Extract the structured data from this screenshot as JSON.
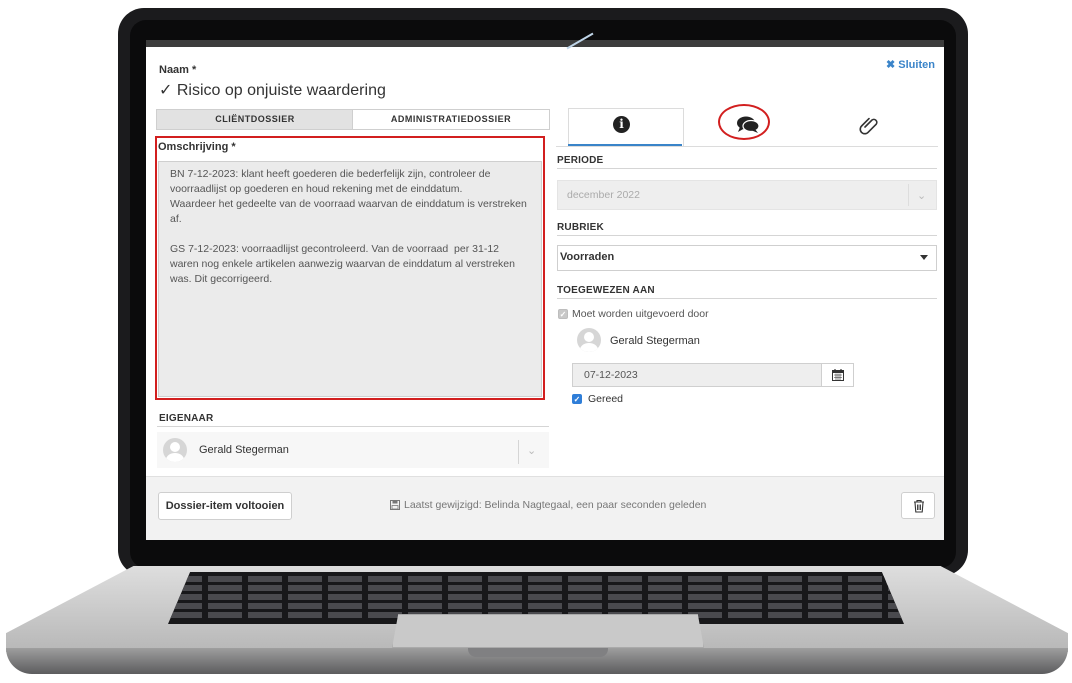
{
  "dialog": {
    "name_label": "Naam *",
    "title_check": "✓",
    "title": "Risico op onjuiste waardering",
    "close_label": "✖ Sluiten"
  },
  "left_tabs": [
    "CLIËNTDOSSIER",
    "ADMINISTRATIEDOSSIER"
  ],
  "description": {
    "label": "Omschrijving *",
    "text": "BN 7-12-2023: klant heeft goederen die bederfelijk zijn, controleer de voorraadlijst op goederen en houd rekening met de einddatum.\nWaardeer het gedeelte van de voorraad waarvan de einddatum is verstreken af.\n\nGS 7-12-2023: voorraadlijst gecontroleerd. Van de voorraad  per 31-12 waren nog enkele artikelen aanwezig waarvan de einddatum al verstreken was. Dit gecorrigeerd."
  },
  "owner": {
    "label": "EIGENAAR",
    "name": "Gerald Stegerman"
  },
  "right_tabs": {
    "icons": [
      "info-icon",
      "comments-icon",
      "paperclip-icon"
    ],
    "active": "info-icon"
  },
  "periode": {
    "label": "PERIODE",
    "value": "december 2022"
  },
  "rubriek": {
    "label": "RUBRIEK",
    "value": "Voorraden"
  },
  "toegewezen": {
    "label": "TOEGEWEZEN AAN",
    "moet_label": "Moet worden uitgevoerd door",
    "moet_checked": true,
    "assignee": "Gerald Stegerman",
    "date": "07-12-2023",
    "gereed_label": "Gereed",
    "gereed_checked": true
  },
  "footer": {
    "complete_button": "Dossier-item voltooien",
    "last_modified": "Laatst gewijzigd: Belinda Nagtegaal, een paar seconden geleden"
  },
  "colors": {
    "accent": "#3a84c9",
    "highlight": "#d21f1f",
    "checkbox": "#2f7ed8"
  }
}
